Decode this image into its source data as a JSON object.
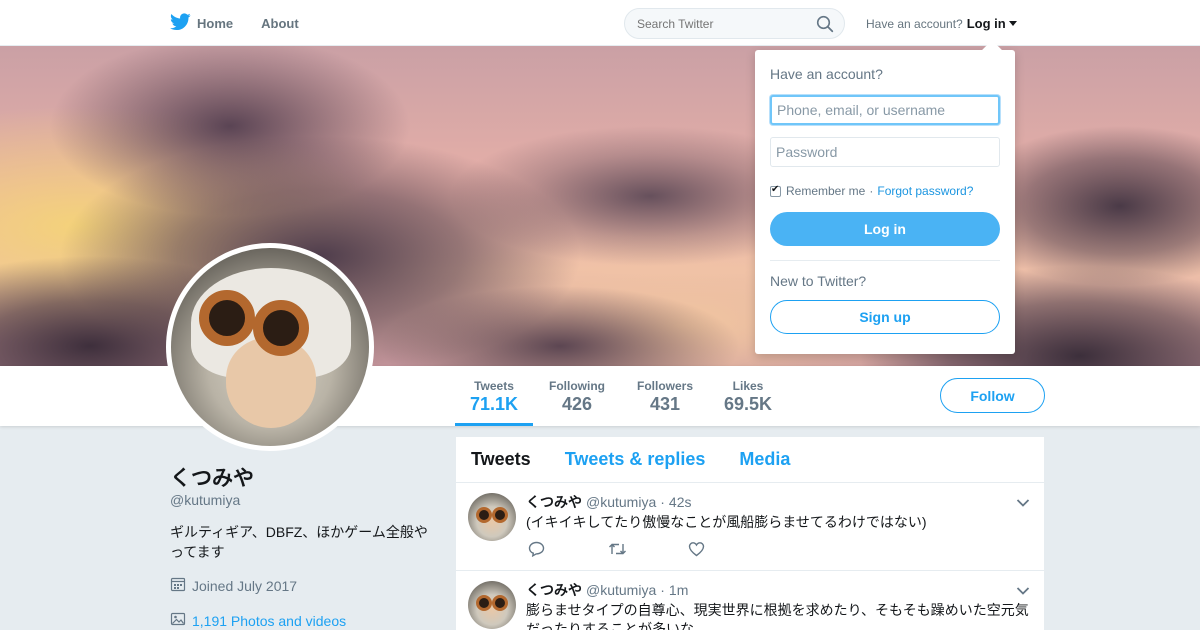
{
  "nav": {
    "home_label": "Home",
    "about_label": "About",
    "search_placeholder": "Search Twitter",
    "account_prompt": "Have an account?",
    "login_label": "Log in"
  },
  "profile": {
    "name": "くつみや",
    "handle": "@kutumiya",
    "bio": "ギルティギア、DBFZ、ほかゲーム全般やってます",
    "joined": "Joined July 2017",
    "photos_videos": "1,191 Photos and videos"
  },
  "stats": [
    {
      "label": "Tweets",
      "value": "71.1K"
    },
    {
      "label": "Following",
      "value": "426"
    },
    {
      "label": "Followers",
      "value": "431"
    },
    {
      "label": "Likes",
      "value": "69.5K"
    }
  ],
  "follow_label": "Follow",
  "timeline": {
    "tabs": [
      "Tweets",
      "Tweets & replies",
      "Media"
    ],
    "tweets": [
      {
        "name": "くつみや",
        "handle": "@kutumiya",
        "time": "42s",
        "text": "(イキイキしてたり傲慢なことが風船膨らませてるわけではない)"
      },
      {
        "name": "くつみや",
        "handle": "@kutumiya",
        "time": "1m",
        "text": "膨らませタイプの自尊心、現実世界に根拠を求めたり、そもそも躁めいた空元気だったりすることが多いな"
      }
    ]
  },
  "login_dropdown": {
    "title": "Have an account?",
    "username_placeholder": "Phone, email, or username",
    "password_placeholder": "Password",
    "remember_label": "Remember me",
    "separator": "·",
    "forgot_label": "Forgot password?",
    "login_button": "Log in",
    "new_prompt": "New to Twitter?",
    "signup_button": "Sign up"
  },
  "colors": {
    "accent": "#1da1f2",
    "login_button": "#4ab3f4",
    "background": "#e6ecf0"
  }
}
